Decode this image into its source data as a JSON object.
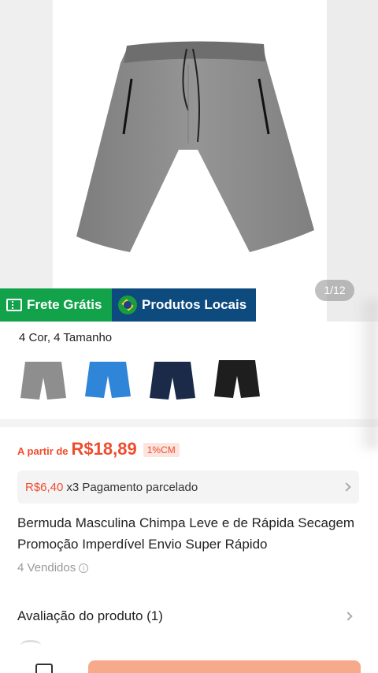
{
  "gallery": {
    "counter": "1/12"
  },
  "badges": {
    "free_shipping": "Frete Grátis",
    "local_products": "Produtos Locais"
  },
  "variants": {
    "summary": "4 Cor, 4 Tamanho",
    "options": [
      {
        "color": "#8e8e8e"
      },
      {
        "color": "#2f86d8"
      },
      {
        "color": "#1c2a4a"
      },
      {
        "color": "#1e1e1e"
      }
    ]
  },
  "price": {
    "prefix": "A partir de",
    "value": "R$18,89",
    "badge": "1%CM"
  },
  "installment": {
    "amount": "R$6,40",
    "text": "x3 Pagamento parcelado"
  },
  "product": {
    "title": "Bermuda Masculina Chimpa Leve e de Rápida Secagem Promoção Imperdível Envio Super Rápido",
    "sold": "4 Vendidos"
  },
  "reviews": {
    "label": "Avaliação do produto (1)"
  },
  "colors": {
    "accent": "#ee4d2d",
    "free_shipping": "#12a34a",
    "local": "#0d4a7e"
  }
}
